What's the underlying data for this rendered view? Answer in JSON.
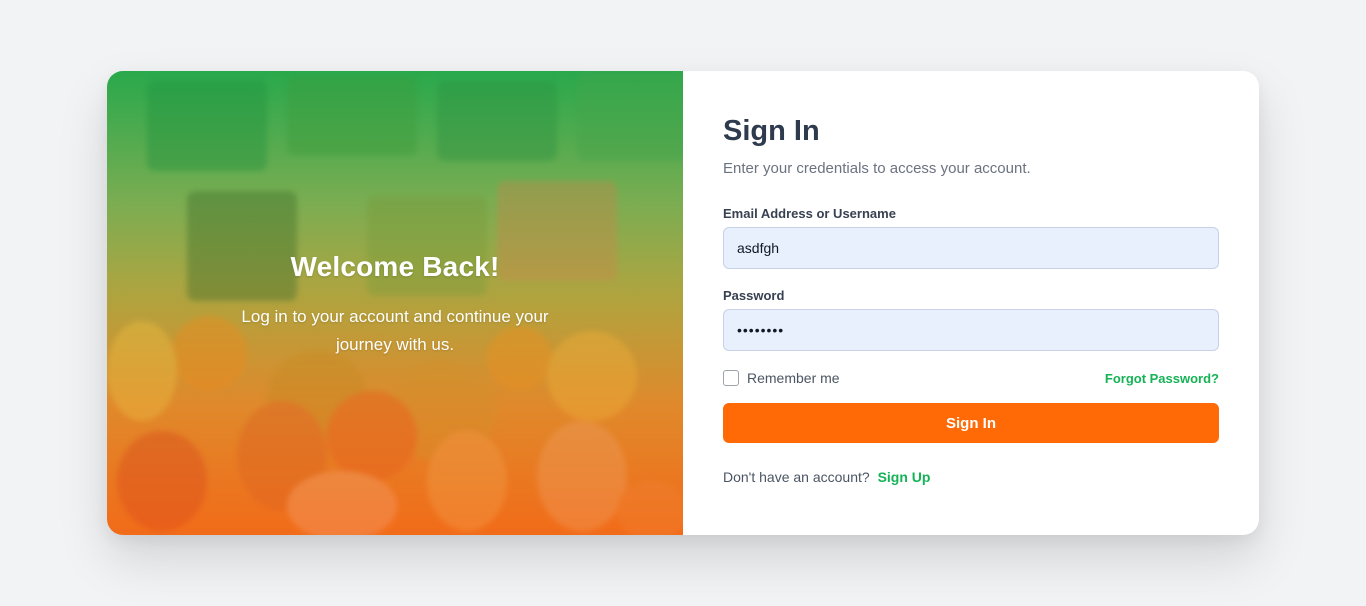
{
  "hero": {
    "title": "Welcome Back!",
    "subtitle": "Log in to your account and continue your journey with us."
  },
  "form": {
    "title": "Sign In",
    "subtitle": "Enter your credentials to access your account.",
    "email_label": "Email Address or Username",
    "email_value": "asdfgh",
    "password_label": "Password",
    "password_value": "••••••••",
    "remember_label": "Remember me",
    "remember_checked": false,
    "forgot_label": "Forgot Password?",
    "submit_label": "Sign In",
    "signup_prompt": "Don't have an account?",
    "signup_link": "Sign Up"
  },
  "colors": {
    "page_bg": "#f2f3f5",
    "accent_orange": "#ff6a06",
    "link_green": "#16b356",
    "title_text": "#2e3a4d",
    "input_bg": "#e8effd"
  },
  "icons": {
    "checkbox": "checkbox-unchecked-icon"
  }
}
